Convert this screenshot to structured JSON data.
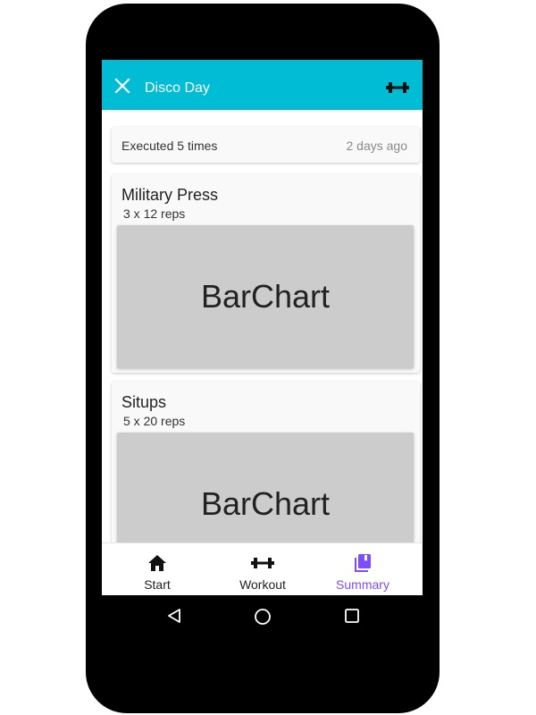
{
  "app_bar": {
    "title": "Disco Day",
    "close_icon": "close-icon",
    "action_icon": "dumbbell-icon",
    "color": "#00bcd4"
  },
  "summary": {
    "executed": "Executed 5 times",
    "ago": "2 days ago"
  },
  "exercises": [
    {
      "name": "Military Press",
      "reps": "3 x 12 reps",
      "chart_label": "BarChart"
    },
    {
      "name": "Situps",
      "reps": "5 x 20 reps",
      "chart_label": "BarChart"
    }
  ],
  "bottom_nav": {
    "items": [
      {
        "label": "Start",
        "icon": "home-icon"
      },
      {
        "label": "Workout",
        "icon": "dumbbell-icon"
      },
      {
        "label": "Summary",
        "icon": "library-books-icon"
      }
    ],
    "active": "Summary",
    "active_color": "#7c4dff"
  },
  "system_nav": {
    "icons": [
      "back-triangle-icon",
      "home-circle-icon",
      "recents-square-icon"
    ]
  }
}
